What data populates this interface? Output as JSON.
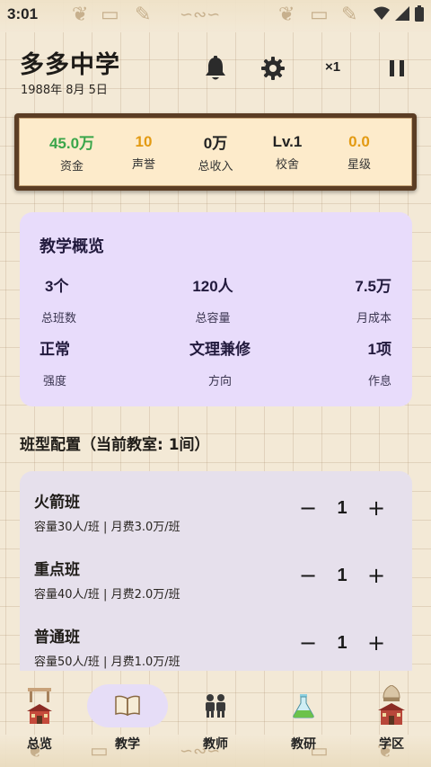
{
  "status_bar": {
    "time": "3:01"
  },
  "header": {
    "school_name": "多多中学",
    "date": "1988年 8月 5日",
    "speed": "×1"
  },
  "stats": [
    {
      "value": "45.0万",
      "label": "资金",
      "color": "#3aa64a"
    },
    {
      "value": "10",
      "label": "声誉",
      "color": "#e39a12"
    },
    {
      "value": "0万",
      "label": "总收入",
      "color": "#222222"
    },
    {
      "value": "Lv.1",
      "label": "校舍",
      "color": "#222222"
    },
    {
      "value": "0.0",
      "label": "星级",
      "color": "#e39a12"
    }
  ],
  "overview": {
    "title": "教学概览",
    "items": [
      {
        "value": "3个",
        "label": "总班数"
      },
      {
        "value": "120人",
        "label": "总容量"
      },
      {
        "value": "7.5万",
        "label": "月成本"
      },
      {
        "value": "正常",
        "label": "强度"
      },
      {
        "value": "文理兼修",
        "label": "方向"
      },
      {
        "value": "1项",
        "label": "作息"
      }
    ]
  },
  "class_config": {
    "title": "班型配置（当前教室: 1间）",
    "classes": [
      {
        "name": "火箭班",
        "desc": "容量30人/班 | 月费3.0万/班",
        "count": "1"
      },
      {
        "name": "重点班",
        "desc": "容量40人/班 | 月费2.0万/班",
        "count": "1"
      },
      {
        "name": "普通班",
        "desc": "容量50人/班 | 月费1.0万/班",
        "count": "1"
      }
    ],
    "minus": "−",
    "plus": "+"
  },
  "nav": [
    {
      "label": "总览",
      "icon": "school-building-icon"
    },
    {
      "label": "教学",
      "icon": "open-book-icon",
      "active": true
    },
    {
      "label": "教师",
      "icon": "teachers-icon"
    },
    {
      "label": "教研",
      "icon": "flask-icon"
    },
    {
      "label": "学区",
      "icon": "district-icon"
    }
  ],
  "colors": {
    "accent_purple": "#e8dcfb",
    "money_green": "#3aa64a",
    "reputation_orange": "#e39a12",
    "frame_brown": "#5b3d24"
  }
}
